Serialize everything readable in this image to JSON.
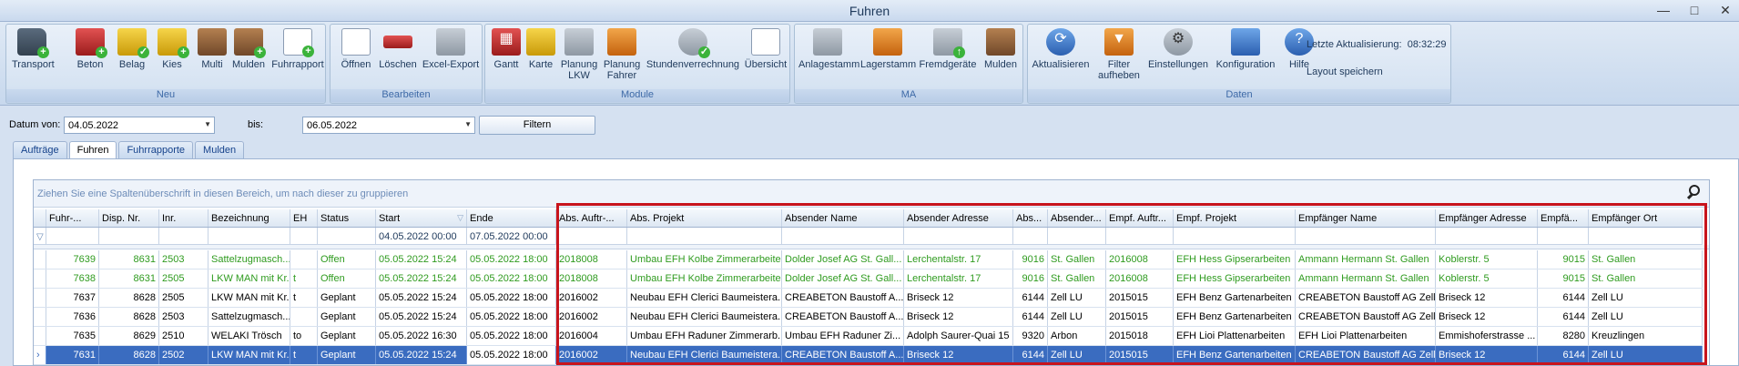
{
  "window": {
    "title": "Fuhren",
    "buttons": [
      "—",
      "□",
      "✕"
    ]
  },
  "ribbon": {
    "groups": [
      {
        "label": "Neu",
        "buttons": [
          {
            "label": "Transport",
            "icon": "truck-icon"
          },
          {
            "label": "Beton",
            "icon": "concrete-mixer-icon"
          },
          {
            "label": "Belag",
            "icon": "paver-icon"
          },
          {
            "label": "Kies",
            "icon": "excavator-icon"
          },
          {
            "label": "Multi",
            "icon": "multi-vehicle-icon"
          },
          {
            "label": "Mulden",
            "icon": "container-icon"
          },
          {
            "label": "Fuhrrapport",
            "icon": "report-icon"
          }
        ]
      },
      {
        "label": "Bearbeiten",
        "buttons": [
          {
            "label": "Öffnen",
            "icon": "open-document-icon"
          },
          {
            "label": "Löschen",
            "icon": "delete-icon"
          },
          {
            "label": "Excel-Export",
            "icon": "printer-icon"
          }
        ]
      },
      {
        "label": "Module",
        "buttons": [
          {
            "label": "Gantt",
            "icon": "calendar-icon"
          },
          {
            "label": "Karte",
            "icon": "map-icon"
          },
          {
            "label": "Planung\nLKW",
            "icon": "truck-planning-icon"
          },
          {
            "label": "Planung\nFahrer",
            "icon": "driver-icon"
          },
          {
            "label": "Stundenverrechnung",
            "icon": "clock-icon"
          },
          {
            "label": "Übersicht",
            "icon": "overview-icon"
          }
        ]
      },
      {
        "label": "MA",
        "buttons": [
          {
            "label": "Anlagestamm",
            "icon": "truck-master-icon"
          },
          {
            "label": "Lagerstamm",
            "icon": "forklift-icon"
          },
          {
            "label": "Fremdgeräte",
            "icon": "external-equipment-icon"
          },
          {
            "label": "Mulden",
            "icon": "container-icon"
          }
        ]
      },
      {
        "label": "Daten",
        "buttons": [
          {
            "label": "Aktualisieren",
            "icon": "refresh-icon"
          },
          {
            "label": "Filter\naufheben",
            "icon": "filter-clear-icon"
          },
          {
            "label": "Einstellungen",
            "icon": "settings-icon"
          },
          {
            "label": "Konfiguration",
            "icon": "database-icon"
          },
          {
            "label": "Hilfe",
            "icon": "help-globe-icon"
          }
        ]
      }
    ],
    "last_update_label": "Letzte Aktualisierung:",
    "last_update_time": "08:32:29",
    "save_layout_label": "Layout speichern"
  },
  "filter": {
    "from_label": "Datum von:",
    "from_value": "04.05.2022",
    "to_label": "bis:",
    "to_value": "06.05.2022",
    "button_label": "Filtern"
  },
  "tabs": [
    {
      "label": "Aufträge",
      "active": false
    },
    {
      "label": "Fuhren",
      "active": true
    },
    {
      "label": "Fuhrrapporte",
      "active": false
    },
    {
      "label": "Mulden",
      "active": false
    }
  ],
  "grid": {
    "group_hint": "Ziehen Sie eine Spaltenüberschrift in diesen Bereich, um nach dieser zu gruppieren",
    "columns": [
      "Fuhr-...",
      "Disp. Nr.",
      "Inr.",
      "Bezeichnung",
      "EH",
      "Status",
      "Start",
      "Ende",
      "Abs. Auftr-...",
      "Abs. Projekt",
      "Absender Name",
      "Absender Adresse",
      "Abs...",
      "Absender...",
      "Empf. Auftr...",
      "Empf. Projekt",
      "Empfänger Name",
      "Empfänger Adresse",
      "Empfä...",
      "Empfänger Ort"
    ],
    "filter_values": {
      "start": "04.05.2022 00:00",
      "ende": "07.05.2022 00:00"
    },
    "rows": [
      {
        "style": "green",
        "cells": [
          "7639",
          "8631",
          "2503",
          "Sattelzugmasch...",
          "",
          "Offen",
          "05.05.2022 15:24",
          "05.05.2022 18:00",
          "2018008",
          "Umbau EFH Kolbe Zimmerarbeiten",
          "Dolder Josef AG St. Gall...",
          "Lerchentalstr. 17",
          "9016",
          "St. Gallen",
          "2016008",
          "EFH Hess Gipserarbeiten",
          "Ammann Hermann St. Gallen",
          "Koblerstr. 5",
          "9015",
          "St. Gallen"
        ]
      },
      {
        "style": "green",
        "cells": [
          "7638",
          "8631",
          "2505",
          "LKW MAN mit Kr...",
          "t",
          "Offen",
          "05.05.2022 15:24",
          "05.05.2022 18:00",
          "2018008",
          "Umbau EFH Kolbe Zimmerarbeiten",
          "Dolder Josef AG St. Gall...",
          "Lerchentalstr. 17",
          "9016",
          "St. Gallen",
          "2016008",
          "EFH Hess Gipserarbeiten",
          "Ammann Hermann St. Gallen",
          "Koblerstr. 5",
          "9015",
          "St. Gallen"
        ]
      },
      {
        "style": "normal",
        "cells": [
          "7637",
          "8628",
          "2505",
          "LKW MAN mit Kr...",
          "t",
          "Geplant",
          "05.05.2022 15:24",
          "05.05.2022 18:00",
          "2016002",
          "Neubau EFH Clerici Baumeistera...",
          "CREABETON Baustoff A...",
          "Briseck 12",
          "6144",
          "Zell LU",
          "2015015",
          "EFH Benz Gartenarbeiten",
          "CREABETON Baustoff AG Zell",
          "Briseck 12",
          "6144",
          "Zell LU"
        ]
      },
      {
        "style": "normal",
        "cells": [
          "7636",
          "8628",
          "2503",
          "Sattelzugmasch...",
          "",
          "Geplant",
          "05.05.2022 15:24",
          "05.05.2022 18:00",
          "2016002",
          "Neubau EFH Clerici Baumeistera...",
          "CREABETON Baustoff A...",
          "Briseck 12",
          "6144",
          "Zell LU",
          "2015015",
          "EFH Benz Gartenarbeiten",
          "CREABETON Baustoff AG Zell",
          "Briseck 12",
          "6144",
          "Zell LU"
        ]
      },
      {
        "style": "normal",
        "cells": [
          "7635",
          "8629",
          "2510",
          "WELAKI Trösch",
          "to",
          "Geplant",
          "05.05.2022 16:30",
          "05.05.2022 18:00",
          "2016004",
          "Umbau EFH Raduner Zimmerarb...",
          "Umbau EFH Raduner Zi...",
          "Adolph Saurer-Quai 15",
          "9320",
          "Arbon",
          "2015018",
          "EFH Lioi Plattenarbeiten",
          "EFH Lioi Plattenarbeiten",
          "Emmishoferstrasse ...",
          "8280",
          "Kreuzlingen"
        ]
      },
      {
        "style": "sel",
        "cells": [
          "7631",
          "8628",
          "2502",
          "LKW MAN mit Kr...",
          "t",
          "Geplant",
          "05.05.2022 15:24",
          "05.05.2022 18:00",
          "2016002",
          "Neubau EFH Clerici Baumeistera...",
          "CREABETON Baustoff A...",
          "Briseck 12",
          "6144",
          "Zell LU",
          "2015015",
          "EFH Benz Gartenarbeiten",
          "CREABETON Baustoff AG Zell",
          "Briseck 12",
          "6144",
          "Zell LU"
        ]
      }
    ]
  },
  "colors": {
    "accent": "#3a6cc0",
    "green_row": "#2f9b1f",
    "highlight_box": "#c8141c"
  }
}
